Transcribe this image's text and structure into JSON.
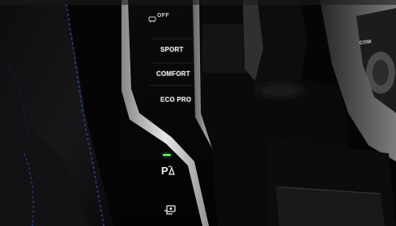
{
  "image": {
    "description": "Car center console drive mode buttons",
    "colors": {
      "button_text": "#eeeeee",
      "led_active": "#7cff6a",
      "console_black": "#050505",
      "chrome": "#d9d9d9",
      "stitching": "#2a4aa0"
    }
  },
  "console": {
    "top_label": "OFF",
    "modes": [
      {
        "label": "SPORT"
      },
      {
        "label": "COMFORT"
      },
      {
        "label": "ECO PRO"
      }
    ],
    "lower_buttons": [
      {
        "icon": "parking-assist-icon"
      },
      {
        "icon": "camera-view-icon"
      }
    ],
    "selector_side_label": "COM"
  }
}
